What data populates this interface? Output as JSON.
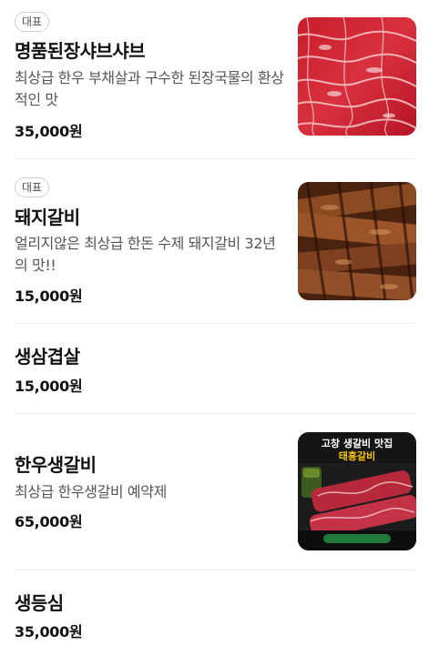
{
  "menu": {
    "items": [
      {
        "badge": "대표",
        "name": "명품된장샤브샤브",
        "desc": "최상급 한우 부채살과 구수한 된장국물의 환상적인 맛",
        "price": "35,000원",
        "image": "marbled-beef-photo"
      },
      {
        "badge": "대표",
        "name": "돼지갈비",
        "desc": "얼리지않은 최상급 한돈 수제 돼지갈비 32년의 맛!!",
        "price": "15,000원",
        "image": "grilled-pork-ribs-photo"
      },
      {
        "name": "생삼겹살",
        "price": "15,000원"
      },
      {
        "name": "한우생갈비",
        "desc": "최상급 한우생갈비 예약제",
        "price": "65,000원",
        "image": "beef-ribs-promo-photo",
        "image_caption_line1": "고창 생갈비 맛집",
        "image_caption_line2": "태흥갈비"
      },
      {
        "name": "생등심",
        "price": "35,000원"
      }
    ]
  }
}
